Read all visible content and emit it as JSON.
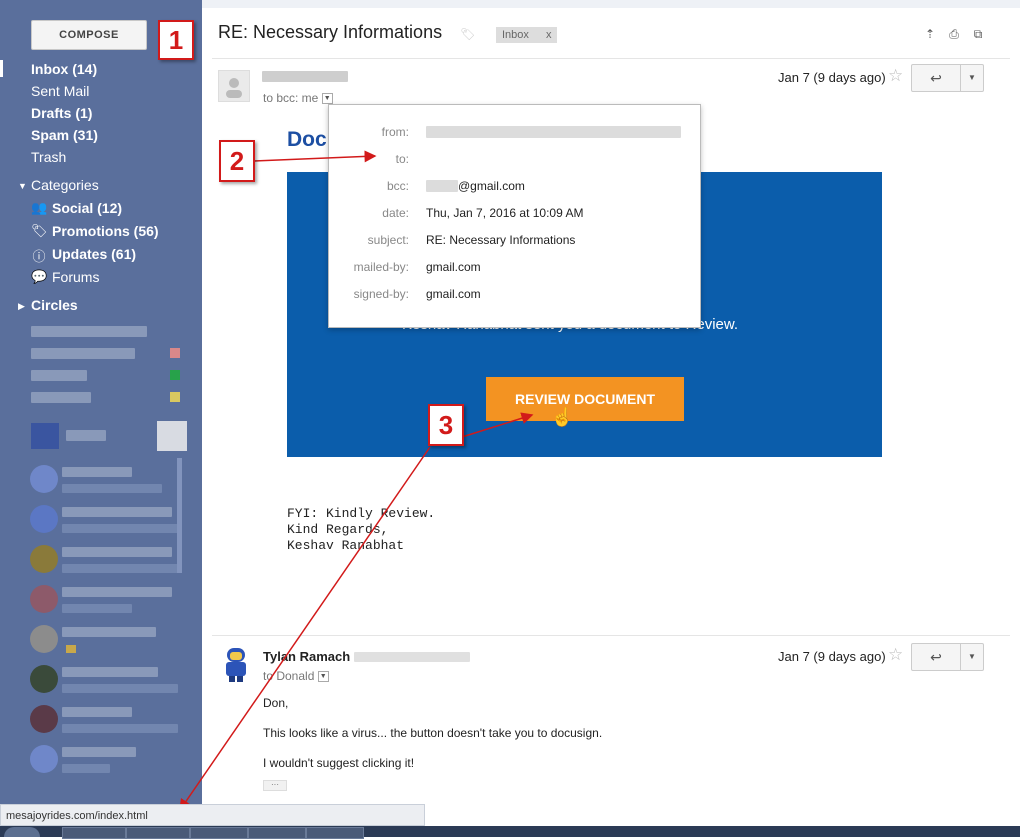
{
  "sidebar": {
    "compose_label": "COMPOSE",
    "nav": [
      {
        "label": "Inbox (14)",
        "bold": true
      },
      {
        "label": "Sent Mail",
        "bold": false
      },
      {
        "label": "Drafts (1)",
        "bold": true
      },
      {
        "label": "Spam (31)",
        "bold": true
      },
      {
        "label": "Trash",
        "bold": false
      }
    ],
    "categories_label": "Categories",
    "categories": [
      {
        "label": "Social (12)",
        "icon": "people-icon"
      },
      {
        "label": "Promotions (56)",
        "icon": "tag-icon"
      },
      {
        "label": "Updates (61)",
        "icon": "info-icon"
      },
      {
        "label": "Forums",
        "icon": "forum-icon"
      }
    ],
    "circles_label": "Circles"
  },
  "annotations": {
    "one": "1",
    "two": "2",
    "three": "3"
  },
  "thread": {
    "subject": "RE: Necessary Informations",
    "label_chip": "Inbox",
    "label_chip_close": "x"
  },
  "message1": {
    "to_line": "to bcc: me",
    "date": "Jan 7 (9 days ago)",
    "logo_text": "Doc",
    "sent_text": "Keshav Ranabhat sent you a document to Review.",
    "review_button": "REVIEW DOCUMENT",
    "body_lines": [
      "FYI: Kindly Review.",
      "Kind Regards,",
      "Keshav Ranabhat"
    ]
  },
  "details_popup": {
    "from_label": "from:",
    "to_label": "to:",
    "bcc_label": "bcc:",
    "bcc_value": "@gmail.com",
    "date_label": "date:",
    "date_value": "Thu, Jan 7, 2016 at 10:09 AM",
    "subject_label": "subject:",
    "subject_value": "RE: Necessary Informations",
    "mailed_label": "mailed-by:",
    "mailed_value": "gmail.com",
    "signed_label": "signed-by:",
    "signed_value": "gmail.com"
  },
  "message2": {
    "sender": "Tylan Ramach",
    "to_line": "to Donald",
    "date": "Jan 7 (9 days ago)",
    "line1": "Don,",
    "line2": "This looks like a virus... the button doesn't take you to docusign.",
    "line3": "I wouldn't suggest clicking it!",
    "ellipsis": "···"
  },
  "status_bar": {
    "url": "mesajoyrides.com/index.html"
  },
  "colors": {
    "sidebar": "#5a6f9c",
    "docusign_blue": "#0b5dab",
    "review_orange": "#f39322",
    "annotation_red": "#d21a1a"
  }
}
